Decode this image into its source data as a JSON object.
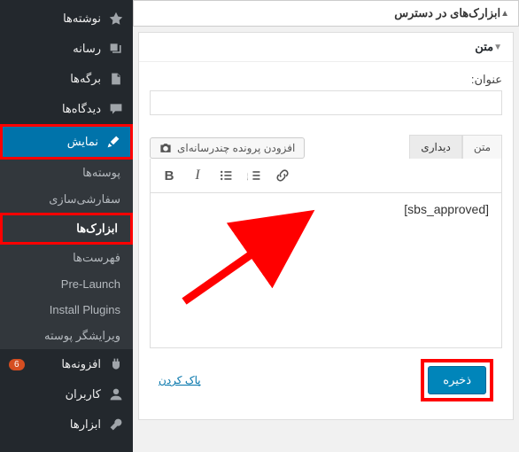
{
  "sidebar": {
    "posts": "نوشته‌ها",
    "media": "رسانه",
    "pages": "برگه‌ها",
    "comments": "دیدگاه‌ها",
    "appearance": "نمایش",
    "themes": "پوسته‌ها",
    "customize": "سفارشی‌سازی",
    "widgets": "ابزارک‌ها",
    "menus": "فهرست‌ها",
    "prelaunch": "Pre-Launch",
    "install_plugins": "Install Plugins",
    "theme_editor": "ویرایشگر پوسته",
    "plugins": "افزونه‌ها",
    "plugins_badge": "6",
    "users": "کاربران",
    "tools": "ابزارها"
  },
  "panel": {
    "available_widgets": "ابزارک‌های در دسترس",
    "text_widget": "متن",
    "title_label": "عنوان:",
    "add_media": "افزودن پرونده چندرسانه‌ای",
    "tab_visual": "دیداری",
    "tab_text": "متن",
    "editor_content": "[sbs_approved]",
    "clear": "پاک کردن",
    "save": "ذخیره"
  }
}
